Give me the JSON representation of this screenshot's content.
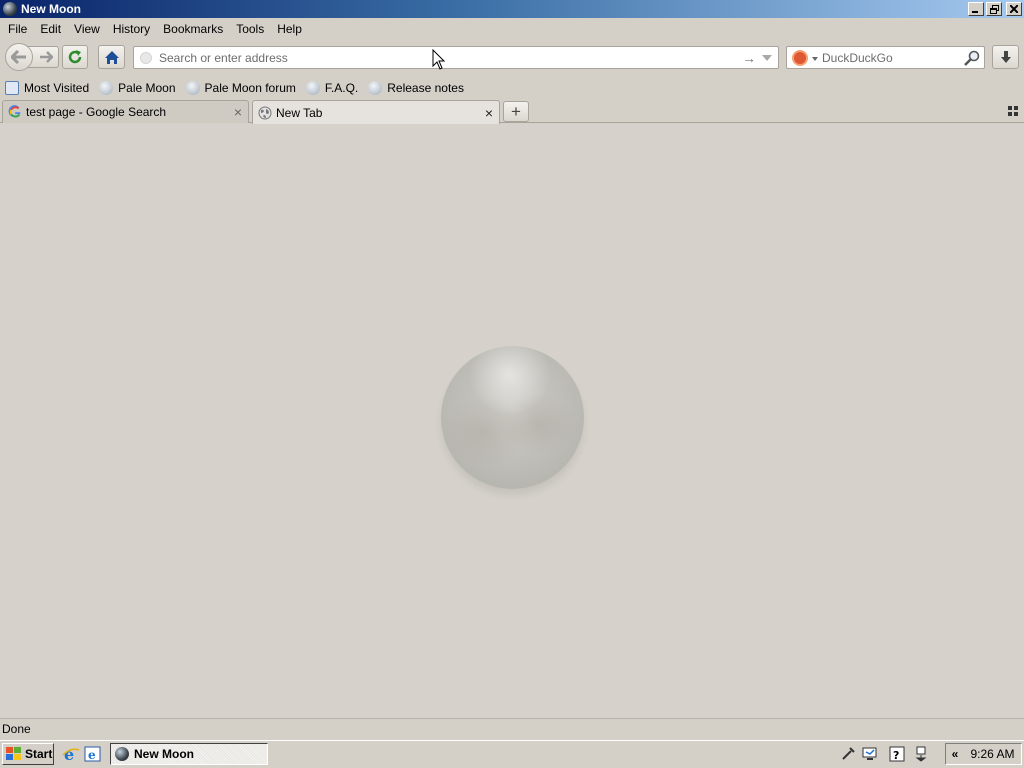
{
  "window": {
    "title": "New Moon"
  },
  "menu": [
    "File",
    "Edit",
    "View",
    "History",
    "Bookmarks",
    "Tools",
    "Help"
  ],
  "navbar": {
    "url_placeholder": "Search or enter address",
    "search_engine": "DuckDuckGo"
  },
  "bookmarks": [
    {
      "label": "Most Visited",
      "icon": "most-visited-icon"
    },
    {
      "label": "Pale Moon",
      "icon": "pale-moon-icon"
    },
    {
      "label": "Pale Moon forum",
      "icon": "pale-moon-icon"
    },
    {
      "label": "F.A.Q.",
      "icon": "pale-moon-icon"
    },
    {
      "label": "Release notes",
      "icon": "pale-moon-icon"
    }
  ],
  "tabs": [
    {
      "label": "test page - Google Search",
      "icon": "google-icon",
      "active": false
    },
    {
      "label": "New Tab",
      "icon": "globe-icon",
      "active": true
    }
  ],
  "status": {
    "text": "Done"
  },
  "taskbar": {
    "start_label": "Start",
    "task_label": "New Moon",
    "clock": "9:26 AM"
  }
}
